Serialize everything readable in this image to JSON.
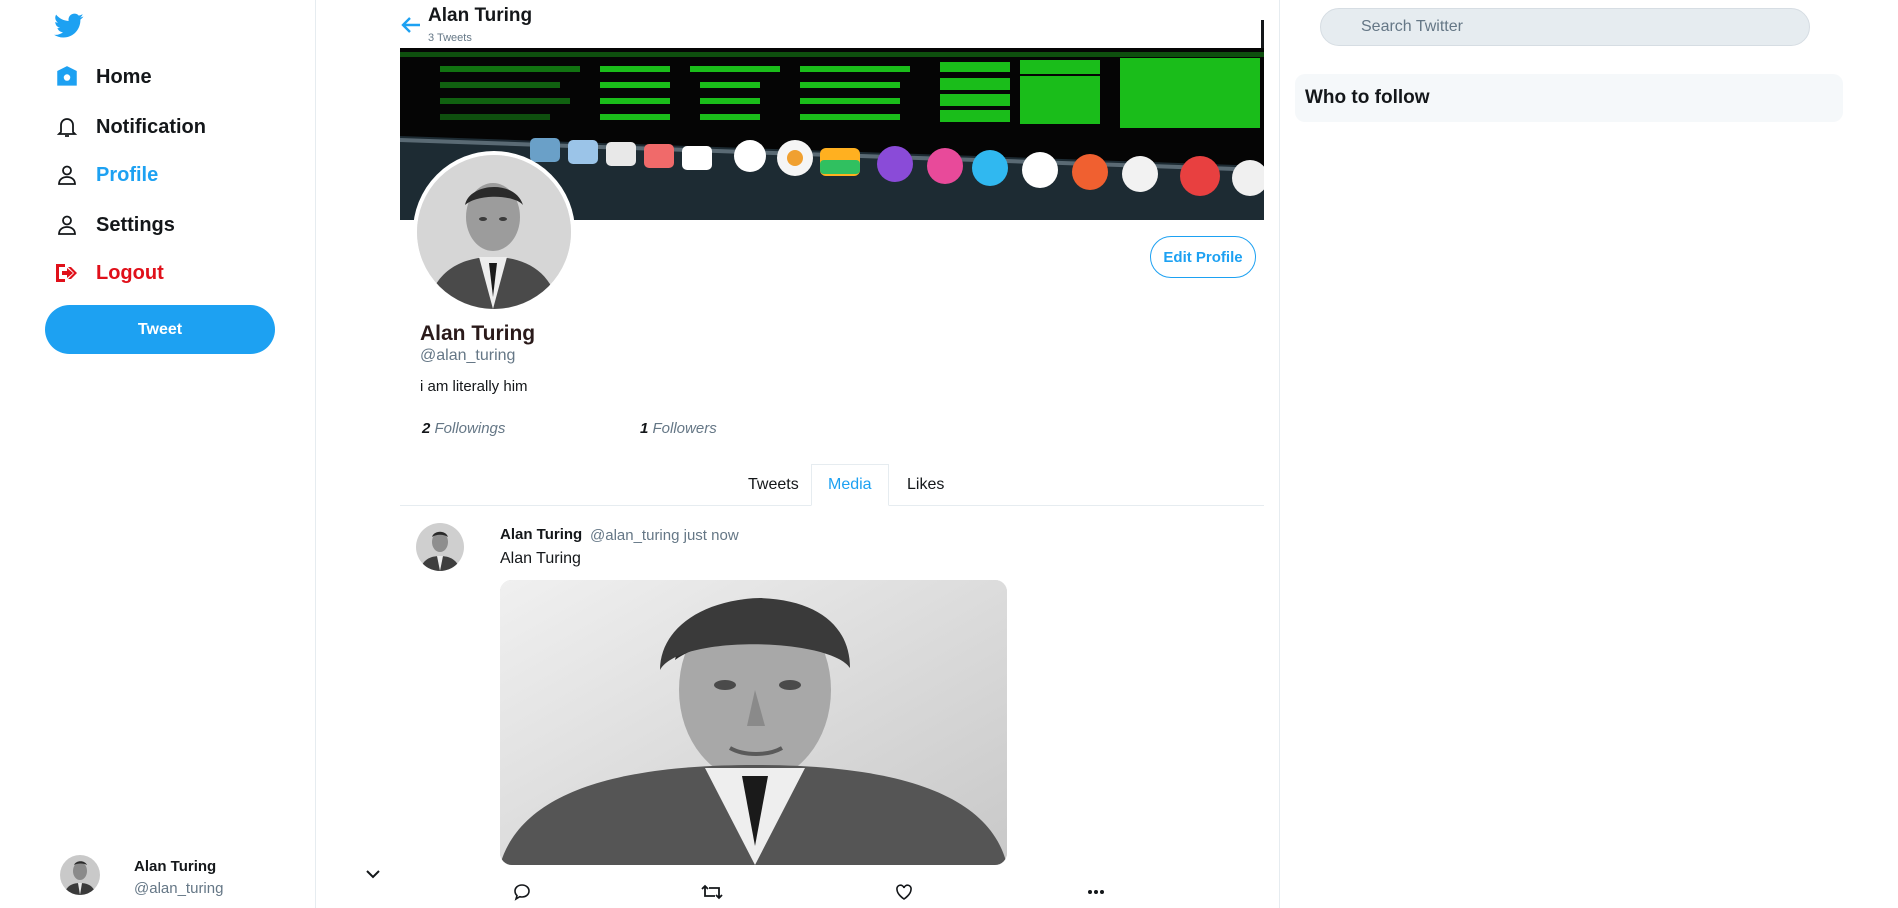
{
  "sidebar": {
    "logo": "twitter-bird-icon",
    "items": [
      {
        "label": "Home",
        "icon": "home-icon"
      },
      {
        "label": "Notification",
        "icon": "bell-icon"
      },
      {
        "label": "Profile",
        "icon": "user-icon"
      },
      {
        "label": "Settings",
        "icon": "user-icon"
      },
      {
        "label": "Logout",
        "icon": "logout-icon"
      }
    ],
    "tweet_button": "Tweet",
    "account": {
      "name": "Alan Turing",
      "handle": "@alan_turing"
    }
  },
  "header": {
    "title": "Alan Turing",
    "subtitle": "3 Tweets"
  },
  "profile": {
    "name": "Alan Turing",
    "handle": "@alan_turing",
    "bio": "i am literally him",
    "edit_button": "Edit Profile",
    "following_count": "2",
    "following_label": "Followings",
    "followers_count": "1",
    "followers_label": "Followers"
  },
  "tabs": [
    {
      "label": "Tweets",
      "active": false
    },
    {
      "label": "Media",
      "active": true
    },
    {
      "label": "Likes",
      "active": false
    }
  ],
  "tweet": {
    "name": "Alan Turing",
    "meta": "@alan_turing just now",
    "text": "Alan Turing",
    "actions": [
      "reply-icon",
      "retweet-icon",
      "like-icon",
      "more-icon"
    ]
  },
  "search": {
    "placeholder": "Search Twitter"
  },
  "who_to_follow": {
    "title": "Who to follow"
  },
  "colors": {
    "accent": "#1da1f2",
    "logout": "#e0101a",
    "banner_green": "#22e022"
  }
}
